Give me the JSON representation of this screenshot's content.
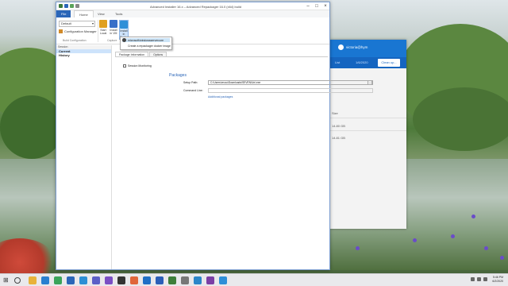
{
  "window": {
    "title": "Advanced Installer 16.x – Advanced Repackager 16.0 (x64) build",
    "tabs": [
      "File",
      "Home",
      "View",
      "Tools"
    ],
    "active_tab": "Home"
  },
  "ribbon": {
    "dropdown_value": "Default",
    "config_manager_label": "Configuration Manager",
    "config_group": "Build Configuration",
    "capture_group": "Capture",
    "buttons": [
      {
        "label": "Start Local",
        "icon": "start-icon"
      },
      {
        "label": "Install in VM",
        "icon": "vm-icon"
      },
      {
        "label": "Install in Docker",
        "icon": "docker-icon"
      }
    ]
  },
  "menu": {
    "items": [
      "microsoft/windowsservercore",
      "Create a repackager docker image"
    ]
  },
  "sidebar": {
    "header": "Session",
    "items": [
      "Current",
      "History"
    ],
    "selected": "Current"
  },
  "content": {
    "tabs": [
      "Package Information",
      "Options"
    ],
    "active_tab": "Package Information",
    "checkbox_label": "Session Monitoring",
    "section_title": "Packages",
    "setup_path_label": "Setup Path:",
    "setup_path_value": "C:\\Users\\vrusu\\Downloads\\SEVEN\\Uni.exe",
    "command_line_label": "Command Line:",
    "command_line_value": "",
    "browse_label": "...",
    "additional_link": "Additional packages"
  },
  "bg_window": {
    "user": "victoria@hym",
    "list_label": "List",
    "date": "1/6/2020",
    "button": "Clean up...",
    "rows": [
      "Size",
      "14.80 GB",
      "14.81 GB"
    ]
  },
  "taskbar": {
    "time": "5:46 PM",
    "date": "6/2/2020",
    "icons": [
      "explorer-icon",
      "edge-icon",
      "chrome-icon",
      "store-icon",
      "vs-code-icon",
      "teams-icon",
      "visual-studio-icon",
      "terminal-icon",
      "firefox-icon",
      "outlook-icon",
      "word-icon",
      "advanced-installer-icon",
      "settings-icon",
      "photos-icon",
      "onenote-icon",
      "docker-icon"
    ]
  },
  "colors": {
    "accent": "#2b66b8",
    "bg_app_accent": "#1976d2"
  }
}
